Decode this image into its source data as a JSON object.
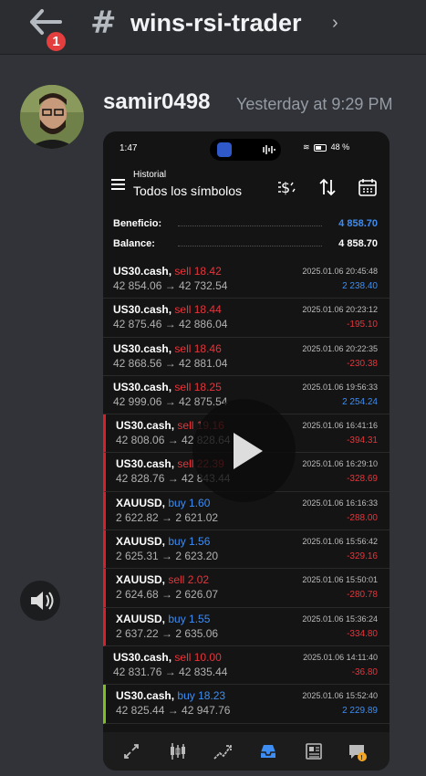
{
  "discord": {
    "back_badge": "1",
    "channel_name": "wins-rsi-trader",
    "message": {
      "username": "samir0498",
      "timestamp": "Yesterday at 9:29 PM"
    }
  },
  "phone": {
    "status": {
      "time": "1:47",
      "battery": "48 %"
    },
    "header": {
      "small": "Historial",
      "title": "Todos los símbolos"
    },
    "summary": [
      {
        "label": "Beneficio:",
        "value": "4 858.70",
        "color": "#3d8df3"
      },
      {
        "label": "Balance:",
        "value": "4 858.70",
        "color": "#ffffff"
      }
    ],
    "rows": [
      {
        "symbol": "US30.cash,",
        "action": "sell 18.42",
        "side": "sell",
        "prices": "42 854.06 → 42 732.54",
        "datetime": "2025.01.06 20:45:48",
        "profit": "2 238.40",
        "pos": true,
        "bar": ""
      },
      {
        "symbol": "US30.cash,",
        "action": "sell 18.44",
        "side": "sell",
        "prices": "42 875.46 → 42 886.04",
        "datetime": "2025.01.06 20:23:12",
        "profit": "-195.10",
        "pos": false,
        "bar": ""
      },
      {
        "symbol": "US30.cash,",
        "action": "sell 18.46",
        "side": "sell",
        "prices": "42 868.56 → 42 881.04",
        "datetime": "2025.01.06 20:22:35",
        "profit": "-230.38",
        "pos": false,
        "bar": ""
      },
      {
        "symbol": "US30.cash,",
        "action": "sell 18.25",
        "side": "sell",
        "prices": "42 999.06 → 42 875.54",
        "datetime": "2025.01.06 19:56:33",
        "profit": "2 254.24",
        "pos": true,
        "bar": ""
      },
      {
        "symbol": "US30.cash,",
        "action": "sell 19.16",
        "side": "sell",
        "prices": "42 808.06 → 42 828.64",
        "datetime": "2025.01.06 16:41:16",
        "profit": "-394.31",
        "pos": false,
        "bar": "red"
      },
      {
        "symbol": "US30.cash,",
        "action": "sell 22.39",
        "side": "sell",
        "prices": "42 828.76 → 42 843.44",
        "datetime": "2025.01.06 16:29:10",
        "profit": "-328.69",
        "pos": false,
        "bar": "red"
      },
      {
        "symbol": "XAUUSD,",
        "action": "buy 1.60",
        "side": "buy",
        "prices": "2 622.82 → 2 621.02",
        "datetime": "2025.01.06 16:16:33",
        "profit": "-288.00",
        "pos": false,
        "bar": "red"
      },
      {
        "symbol": "XAUUSD,",
        "action": "buy 1.56",
        "side": "buy",
        "prices": "2 625.31 → 2 623.20",
        "datetime": "2025.01.06 15:56:42",
        "profit": "-329.16",
        "pos": false,
        "bar": "red"
      },
      {
        "symbol": "XAUUSD,",
        "action": "sell 2.02",
        "side": "sell",
        "prices": "2 624.68 → 2 626.07",
        "datetime": "2025.01.06 15:50:01",
        "profit": "-280.78",
        "pos": false,
        "bar": "red"
      },
      {
        "symbol": "XAUUSD,",
        "action": "buy 1.55",
        "side": "buy",
        "prices": "2 637.22 → 2 635.06",
        "datetime": "2025.01.06 15:36:24",
        "profit": "-334.80",
        "pos": false,
        "bar": "red"
      },
      {
        "symbol": "US30.cash,",
        "action": "sell 10.00",
        "side": "sell",
        "prices": "42 831.76 → 42 835.44",
        "datetime": "2025.01.06 14:11:40",
        "profit": "-36.80",
        "pos": false,
        "bar": ""
      },
      {
        "symbol": "US30.cash,",
        "action": "buy 18.23",
        "side": "buy",
        "prices": "42 825.44 → 42 947.76",
        "datetime": "2025.01.06 15:52:40",
        "profit": "2 229.89",
        "pos": true,
        "bar": "green"
      }
    ]
  }
}
